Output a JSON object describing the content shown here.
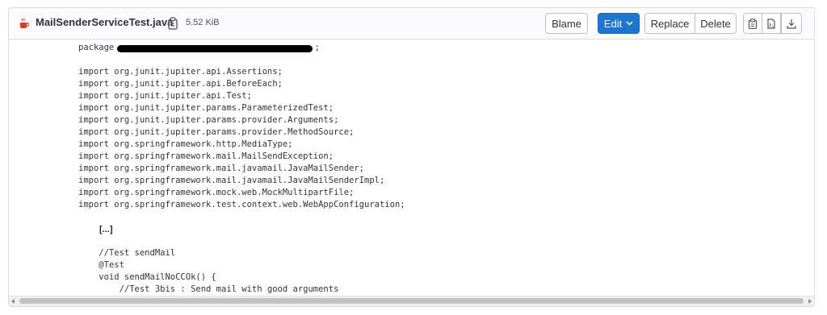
{
  "header": {
    "file_name": "MailSenderServiceTest.java",
    "file_size": "5.52 KiB",
    "file_icon": "java-file-icon",
    "copy_icon": "copy-path-icon"
  },
  "toolbar": {
    "blame_label": "Blame",
    "edit_label": "Edit",
    "replace_label": "Replace",
    "delete_label": "Delete",
    "icons": [
      "copy-contents-icon",
      "open-raw-icon",
      "download-icon"
    ]
  },
  "code": {
    "package_prefix": "package ",
    "package_suffix": ";",
    "imports": [
      "import org.junit.jupiter.api.Assertions;",
      "import org.junit.jupiter.api.BeforeEach;",
      "import org.junit.jupiter.api.Test;",
      "import org.junit.jupiter.params.ParameterizedTest;",
      "import org.junit.jupiter.params.provider.Arguments;",
      "import org.junit.jupiter.params.provider.MethodSource;",
      "import org.springframework.http.MediaType;",
      "import org.springframework.mail.MailSendException;",
      "import org.springframework.mail.javamail.JavaMailSender;",
      "import org.springframework.mail.javamail.JavaMailSenderImpl;",
      "import org.springframework.mock.web.MockMultipartFile;",
      "import org.springframework.test.context.web.WebAppConfiguration;"
    ],
    "ellipsis": "[...]",
    "tail": [
      "    //Test sendMail",
      "    @Test",
      "    void sendMailNoCCOk() {",
      "        //Test 3bis : Send mail with good arguments"
    ]
  },
  "colors": {
    "accent": "#1f75cb",
    "java_icon": "#dd3a2a"
  }
}
